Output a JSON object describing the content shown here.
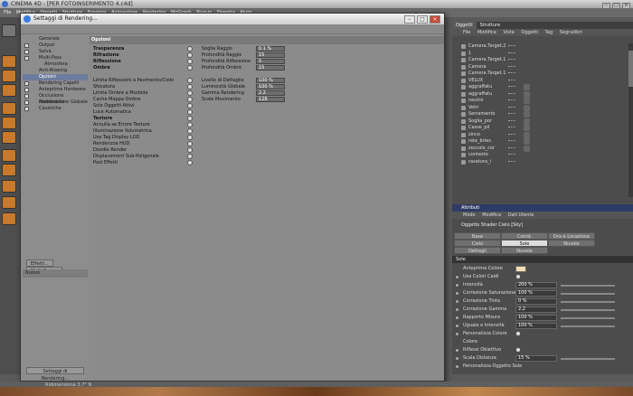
{
  "app": {
    "title": "CINEMA 4D - [PER FOTOINSERIMENTO 4.c4d]"
  },
  "menubar": [
    "File",
    "Modifica",
    "Oggetti",
    "Strutture",
    "Funzioni",
    "Animazione",
    "Rendering",
    "MoGraph",
    "Plug-in",
    "Finestra",
    "Aiuto"
  ],
  "dialog": {
    "title": "Settaggi di Rendering...",
    "nav": [
      {
        "label": "Generale",
        "checked": false,
        "indent": false
      },
      {
        "label": "Output",
        "checked": true,
        "indent": false
      },
      {
        "label": "Salva",
        "checked": true,
        "indent": false
      },
      {
        "label": "Multi-Pass",
        "checked": false,
        "indent": false
      },
      {
        "label": "Atmosfera",
        "checked": false,
        "indent": true
      },
      {
        "label": "Anti-Aliasing",
        "checked": false,
        "indent": false
      },
      {
        "label": "Opzioni",
        "checked": false,
        "indent": false,
        "selected": true
      },
      {
        "label": "Rendering Capelli",
        "checked": true,
        "indent": false
      },
      {
        "label": "Anteprima Hardware",
        "checked": false,
        "indent": false
      },
      {
        "label": "Occlusione Ambientale",
        "checked": true,
        "indent": false
      },
      {
        "label": "Illuminazione Globale",
        "checked": true,
        "indent": false
      },
      {
        "label": "Caustiche",
        "checked": true,
        "indent": false
      }
    ],
    "buttons": {
      "effetti": "Effetti...",
      "multipass": "Multi-Pass...",
      "nuovo": "Nuovo",
      "render_settings": "Settaggi di Rendering..."
    },
    "section_header": "Opzioni",
    "options_left": [
      {
        "label": "Trasparenza",
        "bold": true
      },
      {
        "label": "Rifrazione",
        "bold": true
      },
      {
        "label": "Riflessione",
        "bold": true
      },
      {
        "label": "Ombre",
        "bold": true
      },
      {
        "label": "",
        "bold": false
      },
      {
        "label": "Limita Riflessioni a Pavimento/Cielo",
        "bold": false
      },
      {
        "label": "Sfocatura",
        "bold": false
      },
      {
        "label": "Limita Ombre a Morbide",
        "bold": false
      },
      {
        "label": "Cache Mappa Ombre",
        "bold": false
      },
      {
        "label": "Solo Oggetti Attivi",
        "bold": false
      },
      {
        "label": "Luce Automatica",
        "bold": false
      },
      {
        "label": "Texture",
        "bold": true
      },
      {
        "label": "Annulla se Errore Texture",
        "bold": false
      },
      {
        "label": "Illuminazione Volumetrica",
        "bold": false
      },
      {
        "label": "Usa Tag Display LOD",
        "bold": false
      },
      {
        "label": "Renderizza HUD",
        "bold": false
      },
      {
        "label": "Doodle Render",
        "bold": false
      },
      {
        "label": "Displacement Sub-Poligonale",
        "bold": false
      },
      {
        "label": "Post Effetti",
        "bold": false
      }
    ],
    "options_right": [
      {
        "label": "Soglia Raggio",
        "value": "0.1 %"
      },
      {
        "label": "Profondità Raggio",
        "value": "15"
      },
      {
        "label": "Profondità Riflessione",
        "value": "5"
      },
      {
        "label": "Profondità Ombre",
        "value": "15"
      },
      {
        "label": "",
        "value": ""
      },
      {
        "label": "Livello di Dettaglio",
        "value": "100 %"
      },
      {
        "label": "Luminosità Globale",
        "value": "100 %"
      },
      {
        "label": "Gamma Rendering",
        "value": "2.2"
      },
      {
        "label": "Scale Movimento",
        "value": "128"
      }
    ]
  },
  "objects_panel": {
    "tabs": [
      "Oggetti",
      "Strutture"
    ],
    "menu": [
      "File",
      "Modifica",
      "Vista",
      "Oggetti",
      "Tag",
      "Segnalibri"
    ],
    "items": [
      "Camera.Target.2",
      "1",
      "Camera.Target.1",
      "Camera",
      "Camera.Target.1",
      "VELUX",
      "aggraffatu",
      "aggraffatu",
      "neutro",
      "Vetri",
      "Serramento",
      "Soglia_por",
      "Casse_pil",
      "zinco",
      "rete_bries",
      "zoccolo_cor",
      "contesto",
      "rasatura_i"
    ]
  },
  "attributes_panel": {
    "header": "Attributi",
    "menu": [
      "Modo",
      "Modifica",
      "Dati Utente"
    ],
    "object_title": "Oggetto Shader Cielo [Sky]",
    "tabs_row1": [
      "Base",
      "Coord.",
      "Ora e Locazione"
    ],
    "tabs_row2": [
      "Cielo",
      "Sole",
      "Nuvole"
    ],
    "tabs_row3": [
      "Dettagli",
      "Nuvole Volumetriche"
    ],
    "section": "Sole",
    "attrs": [
      {
        "label": "Anteprima Colore",
        "value": "",
        "type": "swatch"
      },
      {
        "label": "Usa Colori Caldi",
        "value": "",
        "type": "check"
      },
      {
        "label": "Intensità",
        "value": "200 %",
        "type": "num"
      },
      {
        "label": "Correzione Saturazione",
        "value": "100 %",
        "type": "num"
      },
      {
        "label": "Correzione Tinta",
        "value": "0 %",
        "type": "num"
      },
      {
        "label": "Correzione Gamma",
        "value": "2.2",
        "type": "num"
      },
      {
        "label": "Rapporto Misura",
        "value": "100 %",
        "type": "num"
      },
      {
        "label": "Uguale e Intensità",
        "value": "100 %",
        "type": "num"
      },
      {
        "label": "Personalizza Colore",
        "value": "",
        "type": "check"
      },
      {
        "label": "Colore",
        "value": "",
        "type": "text"
      },
      {
        "label": "Riflessi Obiettivo",
        "value": "",
        "type": "check"
      },
      {
        "label": "Scala Distanza",
        "value": "15 %",
        "type": "num"
      },
      {
        "label": "Personalizza Oggetto Sole",
        "value": "",
        "type": "text"
      }
    ]
  },
  "statusbar": {
    "text": "Ridimensiona 3.7° N"
  }
}
